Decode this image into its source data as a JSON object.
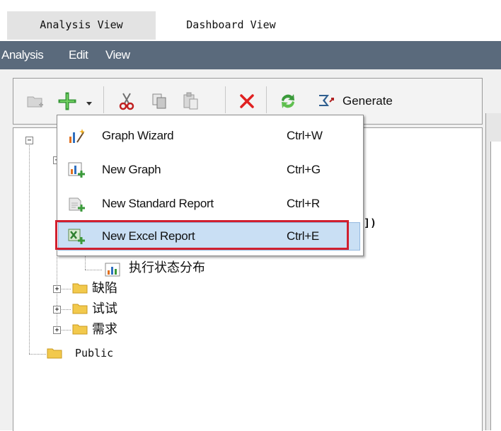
{
  "tabs": [
    {
      "label": "Analysis View",
      "active": true
    },
    {
      "label": "Dashboard View",
      "active": false
    }
  ],
  "menubar": {
    "items": [
      "Analysis",
      "Edit",
      "View"
    ]
  },
  "toolbar": {
    "generate_label": "Generate",
    "icons": [
      "new-folder-icon",
      "add-icon",
      "dropdown-arrow-icon",
      "cut-icon",
      "copy-icon",
      "paste-icon",
      "delete-icon",
      "refresh-icon",
      "generate-icon"
    ]
  },
  "tree": {
    "items": [
      {
        "label": "执行状态分布",
        "icon": "chart-icon"
      },
      {
        "label": "缺陷",
        "icon": "folder-icon"
      },
      {
        "label": "试试",
        "icon": "folder-icon"
      },
      {
        "label": "需求",
        "icon": "folder-icon"
      },
      {
        "label": "Public",
        "icon": "folder-icon"
      }
    ],
    "partial_text": "])"
  },
  "dropdown": {
    "items": [
      {
        "label": "Graph Wizard",
        "shortcut": "Ctrl+W",
        "icon": "graph-wizard-icon"
      },
      {
        "label": "New Graph",
        "shortcut": "Ctrl+G",
        "icon": "new-graph-icon"
      },
      {
        "label": "New Standard Report",
        "shortcut": "Ctrl+R",
        "icon": "new-standard-report-icon"
      },
      {
        "label": "New Excel Report",
        "shortcut": "Ctrl+E",
        "icon": "new-excel-report-icon",
        "highlighted": true
      }
    ]
  },
  "colors": {
    "menubar_bg": "#5a6a7c",
    "highlight_bg": "#c9dff4",
    "red_box": "#d1202f",
    "delete_red": "#e02020"
  }
}
